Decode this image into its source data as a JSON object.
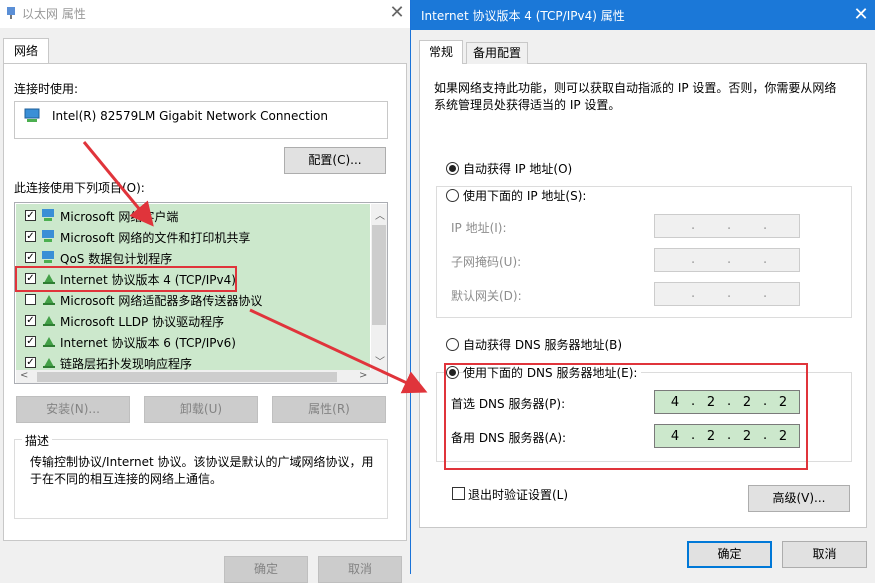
{
  "left_dialog": {
    "title": "以太网 属性",
    "tab": "网络",
    "connect_using_label": "连接时使用:",
    "adapter_name": "Intel(R) 82579LM Gigabit Network Connection",
    "config_button": "配置(C)...",
    "items_label": "此连接使用下列项目(O):",
    "items": [
      {
        "label": "Microsoft 网络客户端",
        "checked": true,
        "icon": "network-client-icon"
      },
      {
        "label": "Microsoft 网络的文件和打印机共享",
        "checked": true,
        "icon": "network-share-icon"
      },
      {
        "label": "QoS 数据包计划程序",
        "checked": true,
        "icon": "qos-icon"
      },
      {
        "label": "Internet 协议版本 4 (TCP/IPv4)",
        "checked": true,
        "icon": "protocol-icon"
      },
      {
        "label": "Microsoft 网络适配器多路传送器协议",
        "checked": false,
        "icon": "protocol-icon"
      },
      {
        "label": "Microsoft LLDP 协议驱动程序",
        "checked": true,
        "icon": "protocol-icon"
      },
      {
        "label": "Internet 协议版本 6 (TCP/IPv6)",
        "checked": true,
        "icon": "protocol-icon"
      },
      {
        "label": "链路层拓扑发现响应程序",
        "checked": true,
        "icon": "protocol-icon"
      }
    ],
    "install_button": "安装(N)...",
    "uninstall_button": "卸载(U)",
    "properties_button": "属性(R)",
    "description_title": "描述",
    "description_text": "传输控制协议/Internet 协议。该协议是默认的广域网络协议，用于在不同的相互连接的网络上通信。",
    "ok_button": "确定",
    "cancel_button": "取消"
  },
  "right_dialog": {
    "title": "Internet 协议版本 4 (TCP/IPv4) 属性",
    "tabs": [
      "常规",
      "备用配置"
    ],
    "intro_text": "如果网络支持此功能，则可以获取自动指派的 IP 设置。否则，你需要从网络系统管理员处获得适当的 IP 设置。",
    "auto_ip_label": "自动获得 IP 地址(O)",
    "manual_ip_label": "使用下面的 IP 地址(S):",
    "ip_address_label": "IP 地址(I):",
    "subnet_label": "子网掩码(U):",
    "gateway_label": "默认网关(D):",
    "ip_dot": ".",
    "auto_dns_label": "自动获得 DNS 服务器地址(B)",
    "manual_dns_label": "使用下面的 DNS 服务器地址(E):",
    "preferred_dns_label": "首选 DNS 服务器(P):",
    "alternate_dns_label": "备用 DNS 服务器(A):",
    "preferred_dns": [
      "4",
      "2",
      "2",
      "2"
    ],
    "alternate_dns": [
      "4",
      "2",
      "2",
      "2"
    ],
    "validate_label": "退出时验证设置(L)",
    "advanced_button": "高级(V)...",
    "ok_button": "确定",
    "cancel_button": "取消",
    "ip_mode": "auto",
    "dns_mode": "manual"
  },
  "colors": {
    "title_blue": "#1b78d8",
    "highlight_red": "#e0343b",
    "selection_green": "#cce8cc"
  }
}
